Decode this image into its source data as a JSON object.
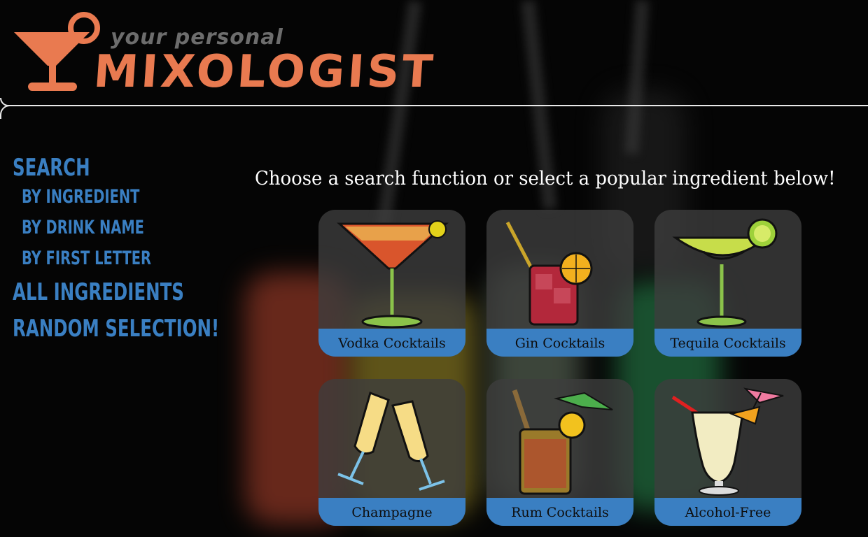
{
  "logo": {
    "tagline": "your personal",
    "title": "MIXOLOGIST",
    "brand_color": "#e97a50"
  },
  "sidebar": {
    "search_label": "Search",
    "search_items": [
      {
        "label": "By Ingredient"
      },
      {
        "label": "By Drink Name"
      },
      {
        "label": "By First Letter"
      }
    ],
    "all_ingredients_label": "All Ingredients",
    "random_label": "Random Selection!",
    "link_color": "#3a7fc2"
  },
  "main": {
    "prompt": "Choose a search function or select a popular ingredient below!",
    "cards": [
      {
        "label": "Vodka Cocktails",
        "icon": "martini-icon"
      },
      {
        "label": "Gin Cocktails",
        "icon": "highball-glass-icon"
      },
      {
        "label": "Tequila Cocktails",
        "icon": "margarita-icon"
      },
      {
        "label": "Champagne",
        "icon": "champagne-toast-icon"
      },
      {
        "label": "Rum Cocktails",
        "icon": "rum-glass-icon"
      },
      {
        "label": "Alcohol-Free",
        "icon": "pina-colada-icon"
      }
    ]
  }
}
